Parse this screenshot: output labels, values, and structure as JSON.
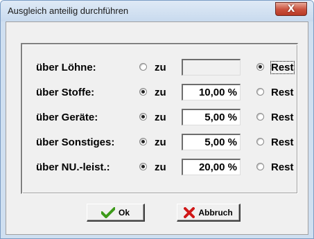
{
  "window": {
    "title": "Ausgleich anteilig durchführen",
    "close_glyph": "X"
  },
  "rows": [
    {
      "label": "über Löhne:",
      "zu_checked": false,
      "zu_label": "zu",
      "value": "",
      "disabled": true,
      "rest_checked": true,
      "rest_label": "Rest"
    },
    {
      "label": "über Stoffe:",
      "zu_checked": true,
      "zu_label": "zu",
      "value": "10,00 %",
      "disabled": false,
      "rest_checked": false,
      "rest_label": "Rest"
    },
    {
      "label": "über Geräte:",
      "zu_checked": true,
      "zu_label": "zu",
      "value": "5,00 %",
      "disabled": false,
      "rest_checked": false,
      "rest_label": "Rest"
    },
    {
      "label": "über Sonstiges:",
      "zu_checked": true,
      "zu_label": "zu",
      "value": "5,00 %",
      "disabled": false,
      "rest_checked": false,
      "rest_label": "Rest"
    },
    {
      "label": "über NU.-leist.:",
      "zu_checked": true,
      "zu_label": "zu",
      "value": "20,00 %",
      "disabled": false,
      "rest_checked": false,
      "rest_label": "Rest"
    }
  ],
  "buttons": {
    "ok_label": "Ok",
    "cancel_label": "Abbruch",
    "ok_icon": "checkmark-icon",
    "cancel_icon": "red-x-icon"
  },
  "colors": {
    "ok_icon": "#3d9a1a",
    "cancel_icon": "#d01818",
    "titlebar": "#d6e4f3",
    "close_button": "#c9503c"
  }
}
